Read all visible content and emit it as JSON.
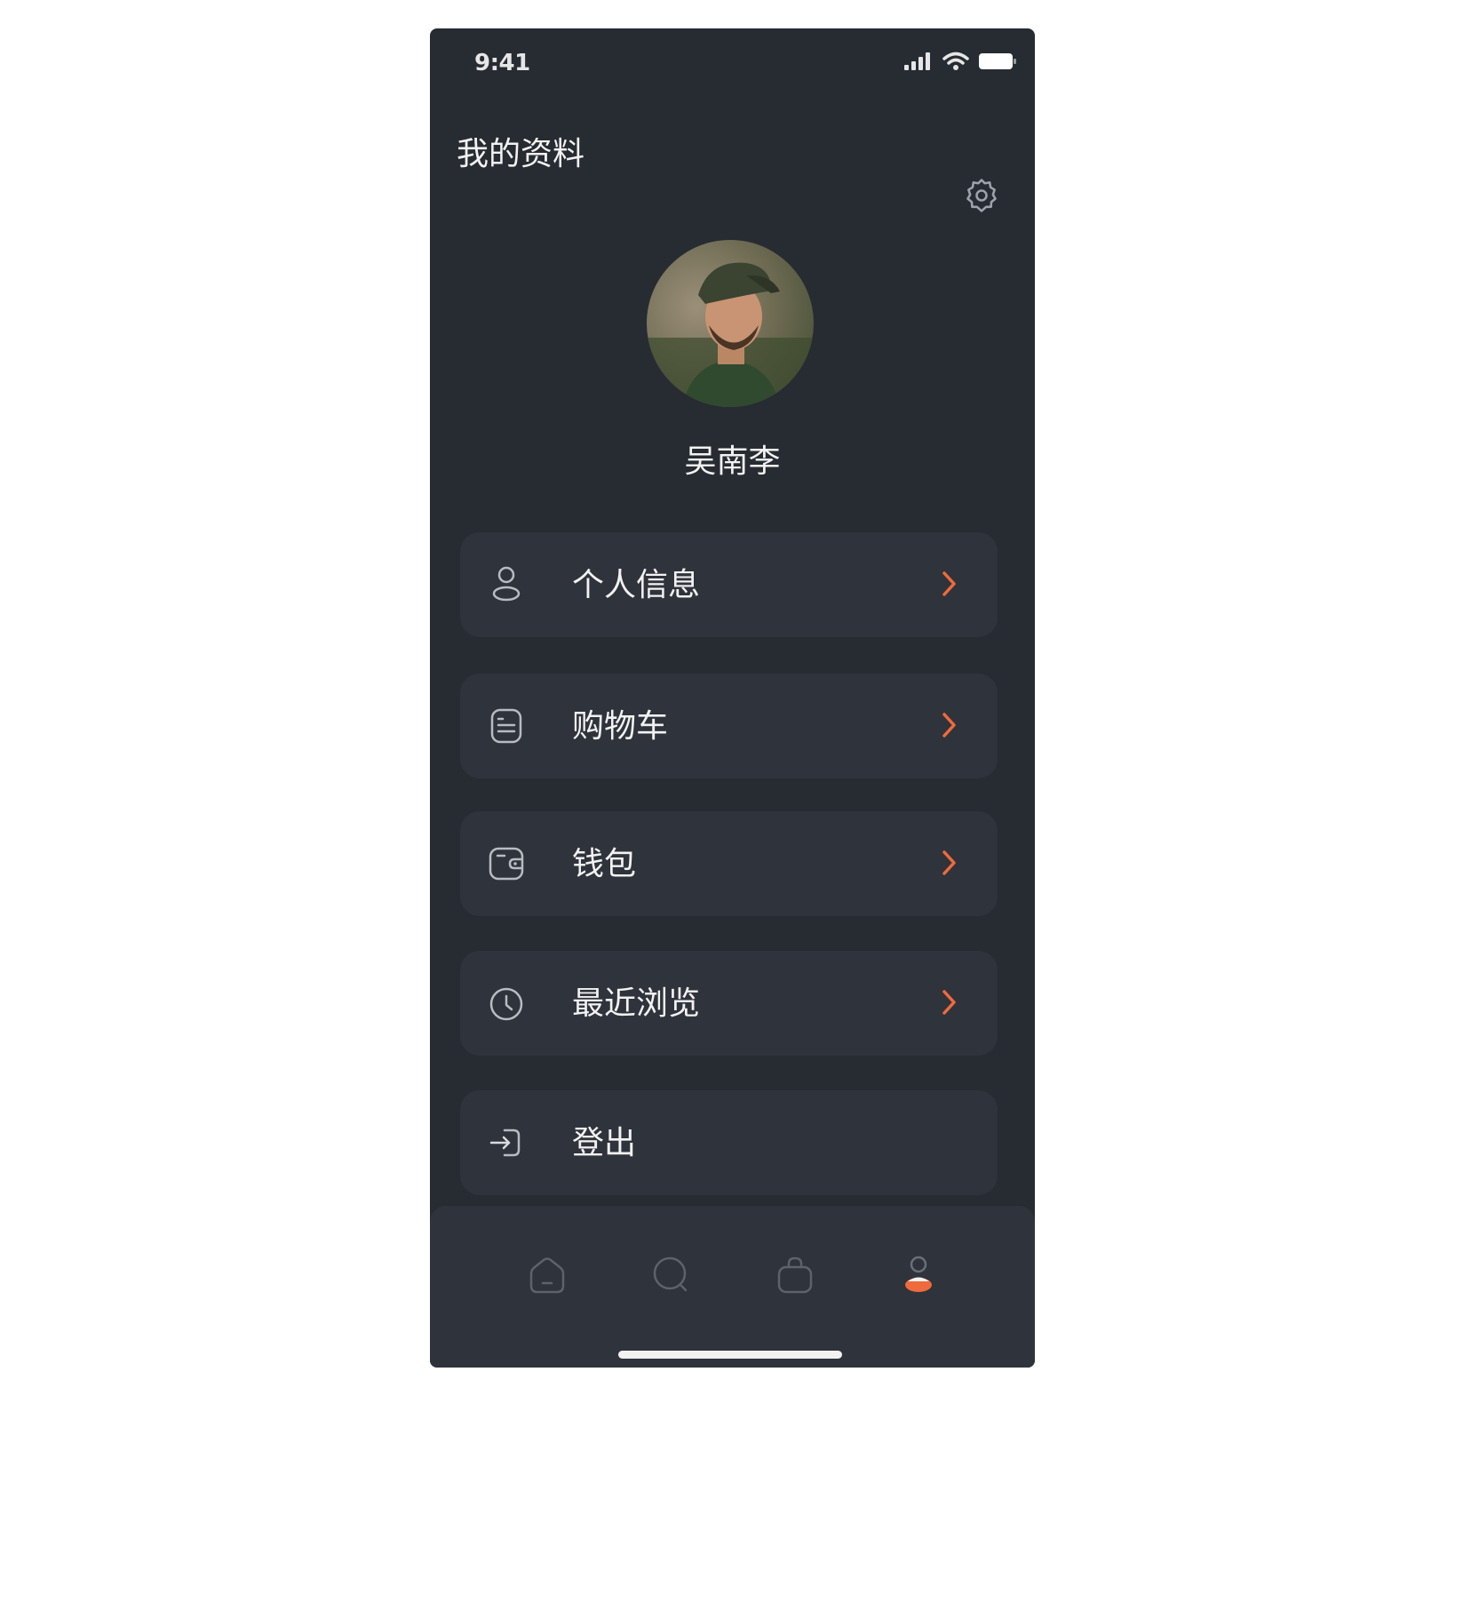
{
  "status_bar": {
    "time": "9:41"
  },
  "header": {
    "title": "我的资料"
  },
  "profile": {
    "name": "吴南李"
  },
  "menu": [
    {
      "label": "个人信息",
      "icon": "user-icon",
      "has_chevron": true
    },
    {
      "label": "购物车",
      "icon": "document-icon",
      "has_chevron": true
    },
    {
      "label": "钱包",
      "icon": "wallet-icon",
      "has_chevron": true
    },
    {
      "label": "最近浏览",
      "icon": "clock-icon",
      "has_chevron": true
    },
    {
      "label": "登出",
      "icon": "logout-icon",
      "has_chevron": false
    }
  ],
  "tab_bar": {
    "tabs": [
      {
        "icon": "home-icon",
        "active": false
      },
      {
        "icon": "search-icon",
        "active": false
      },
      {
        "icon": "bag-icon",
        "active": false
      },
      {
        "icon": "profile-icon",
        "active": true
      }
    ]
  },
  "colors": {
    "background": "#272b32",
    "card": "#2f333b",
    "accent": "#ef6a3c",
    "text": "#f2f2f2",
    "icon_muted": "#9ea3ab"
  }
}
